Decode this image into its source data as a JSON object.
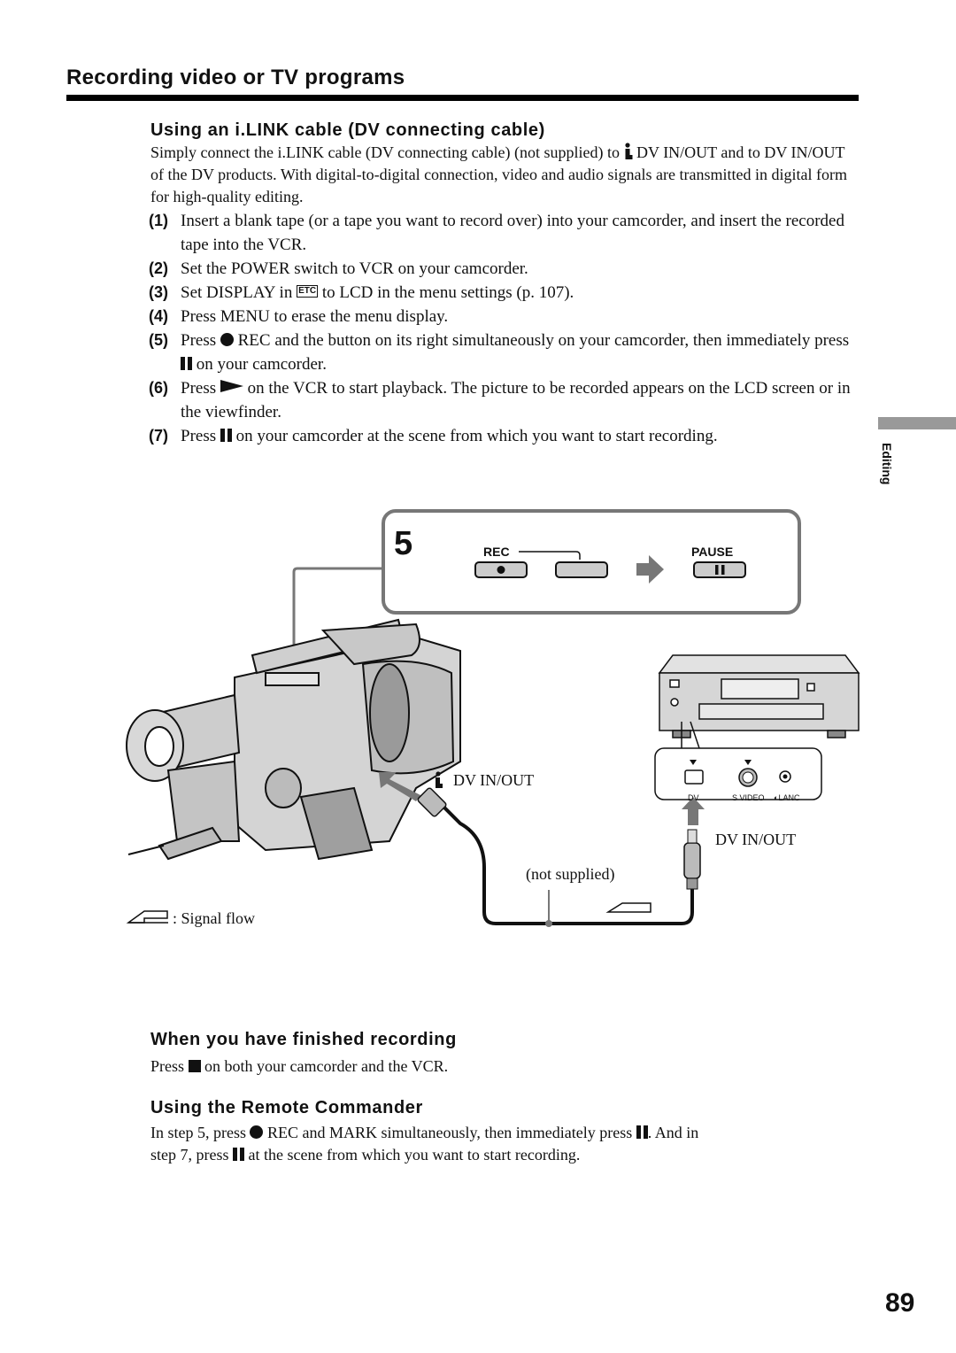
{
  "page": {
    "title": "Recording video or TV programs",
    "side_tab_label": "Editing",
    "page_number": "89"
  },
  "section_ilink": {
    "heading": "Using an i.LINK cable (DV connecting cable)",
    "intro_part1": "Simply connect the i.LINK cable (DV connecting cable) (not supplied) to",
    "intro_part2": "DV IN/OUT and to DV IN/OUT of the DV products.  With digital-to-digital connection, video and audio signals are transmitted in digital form for high-quality editing.",
    "steps": [
      {
        "num": "(1)",
        "text": "Insert a blank tape (or a tape you want to record over) into your camcorder, and insert the recorded tape into the VCR."
      },
      {
        "num": "(2)",
        "text": "Set the POWER switch to VCR on your camcorder."
      },
      {
        "num": "(3)",
        "pre": "Set DISPLAY in",
        "icon": "ETC",
        "post": "to LCD in the menu settings (p. 107)."
      },
      {
        "num": "(4)",
        "text": "Press MENU to erase the menu display."
      },
      {
        "num": "(5)",
        "pre": "Press",
        "mid": "REC and the button on its right simultaneously on your camcorder, then immediately press",
        "post": "on your camcorder."
      },
      {
        "num": "(6)",
        "pre": "Press",
        "post": "on the VCR to start playback. The picture to be recorded appears on the LCD screen or in the viewfinder."
      },
      {
        "num": "(7)",
        "pre": "Press",
        "post": "on your camcorder at the scene from which you want to start recording."
      }
    ]
  },
  "diagram": {
    "step_callout_number": "5",
    "rec_label": "REC",
    "pause_label": "PAUSE",
    "camcorder_port_label": "DV IN/OUT",
    "vcr_port_label": "DV IN/OUT",
    "cable_note": "(not supplied)",
    "vcr_jacks": [
      "DV",
      "S VIDEO",
      "LANC"
    ],
    "legend_text": ": Signal flow"
  },
  "section_finished": {
    "heading": "When you have finished recording",
    "text_pre": "Press",
    "text_post": "on both your camcorder and the VCR."
  },
  "section_remote": {
    "heading": "Using the Remote Commander",
    "line1_pre": "In step 5, press",
    "line1_mid": "REC and MARK simultaneously, then immediately press",
    "line1_post": ". And in",
    "line2_pre": "step 7, press",
    "line2_post": "at the scene from which you want to start recording."
  }
}
